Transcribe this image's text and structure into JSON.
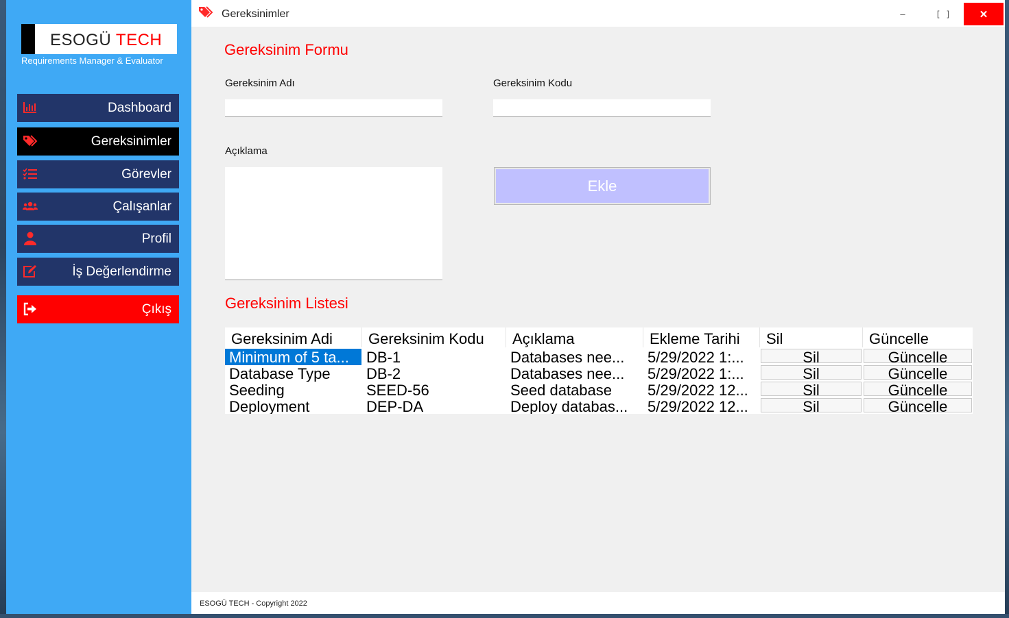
{
  "sidebar": {
    "logo_main": "ESOGÜ",
    "logo_accent": "TECH",
    "logo_subtitle": "Requirements Manager & Evaluator",
    "items": [
      {
        "label": "Dashboard",
        "icon": "chart-icon"
      },
      {
        "label": "Gereksinimler",
        "icon": "tags-icon",
        "active": true
      },
      {
        "label": "Görevler",
        "icon": "task-list-icon"
      },
      {
        "label": "Çalışanlar",
        "icon": "users-icon"
      },
      {
        "label": "Profil",
        "icon": "user-icon"
      },
      {
        "label": "İş Değerlendirme",
        "icon": "edit-icon"
      }
    ],
    "exit_label": "Çıkış"
  },
  "window": {
    "title": "Gereksinimler",
    "minimize": "–",
    "maximize": "[ ]",
    "close": "✕"
  },
  "form": {
    "title": "Gereksinim Formu",
    "name_label": "Gereksinim Adı",
    "name_value": "",
    "code_label": "Gereksinim Kodu",
    "code_value": "",
    "desc_label": "Açıklama",
    "desc_value": "",
    "add_button": "Ekle"
  },
  "list": {
    "title": "Gereksinim Listesi",
    "columns": [
      "Gereksinim Adi",
      "Gereksinim Kodu",
      "Açıklama",
      "Ekleme Tarihi",
      "Sil",
      "Güncelle"
    ],
    "rows": [
      {
        "name": "Minimum of 5 ta...",
        "code": "DB-1",
        "desc": "Databases nee...",
        "date": "5/29/2022 1:...",
        "delete": "Sil",
        "update": "Güncelle",
        "selected": true
      },
      {
        "name": "Database Type",
        "code": "DB-2",
        "desc": "Databases nee...",
        "date": "5/29/2022 1:...",
        "delete": "Sil",
        "update": "Güncelle"
      },
      {
        "name": "Seeding",
        "code": "SEED-56",
        "desc": "Seed database",
        "date": "5/29/2022 12...",
        "delete": "Sil",
        "update": "Güncelle"
      },
      {
        "name": "Deployment",
        "code": "DEP-DA",
        "desc": "Deploy databas...",
        "date": "5/29/2022 12...",
        "delete": "Sil",
        "update": "Güncelle"
      }
    ]
  },
  "footer": {
    "text": "ESOGÜ TECH - Copyright 2022"
  },
  "colors": {
    "sidebar_bg": "#3fa9f5",
    "nav_bg": "#223569",
    "accent_red": "#ff0000",
    "add_button_bg": "#c0c0ff",
    "selection": "#0078d7"
  }
}
